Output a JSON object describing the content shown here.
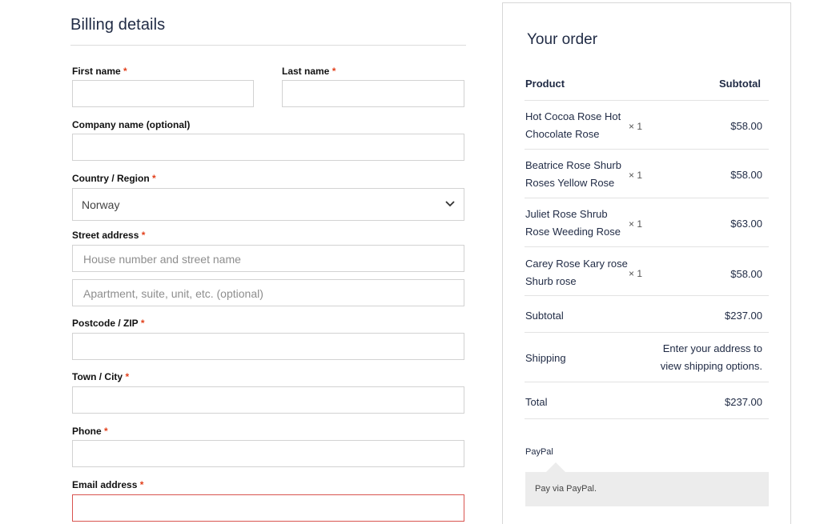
{
  "billing": {
    "title": "Billing details",
    "required_marker": "*",
    "first_name_label": "First name",
    "last_name_label": "Last name",
    "company_label": "Company name (optional)",
    "country_label": "Country / Region",
    "country_value": "Norway",
    "street_label": "Street address",
    "street_placeholder": "House number and street name",
    "street2_placeholder": "Apartment, suite, unit, etc. (optional)",
    "postcode_label": "Postcode / ZIP",
    "city_label": "Town / City",
    "phone_label": "Phone",
    "email_label": "Email address"
  },
  "order": {
    "title": "Your order",
    "col_product": "Product",
    "col_subtotal": "Subtotal",
    "items": [
      {
        "name": "Hot Cocoa Rose Hot Chocolate Rose",
        "qty": "× 1",
        "price": "$58.00"
      },
      {
        "name": "Beatrice Rose Shurb Roses Yellow Rose",
        "qty": "× 1",
        "price": "$58.00"
      },
      {
        "name": "Juliet Rose Shrub Rose Weeding Rose",
        "qty": "× 1",
        "price": "$63.00"
      },
      {
        "name": "Carey Rose Kary rose Shurb rose",
        "qty": "× 1",
        "price": "$58.00"
      }
    ],
    "subtotal_label": "Subtotal",
    "subtotal_value": "$237.00",
    "shipping_label": "Shipping",
    "shipping_note": "Enter your address to view shipping options.",
    "total_label": "Total",
    "total_value": "$237.00",
    "payment_method": "PayPal",
    "payment_description": "Pay via PayPal."
  },
  "colors": {
    "required": "#e2401c",
    "error_border": "#d9534f",
    "heading": "#1f2a44"
  },
  "icons": {
    "country_select": "chevron-down-icon"
  }
}
